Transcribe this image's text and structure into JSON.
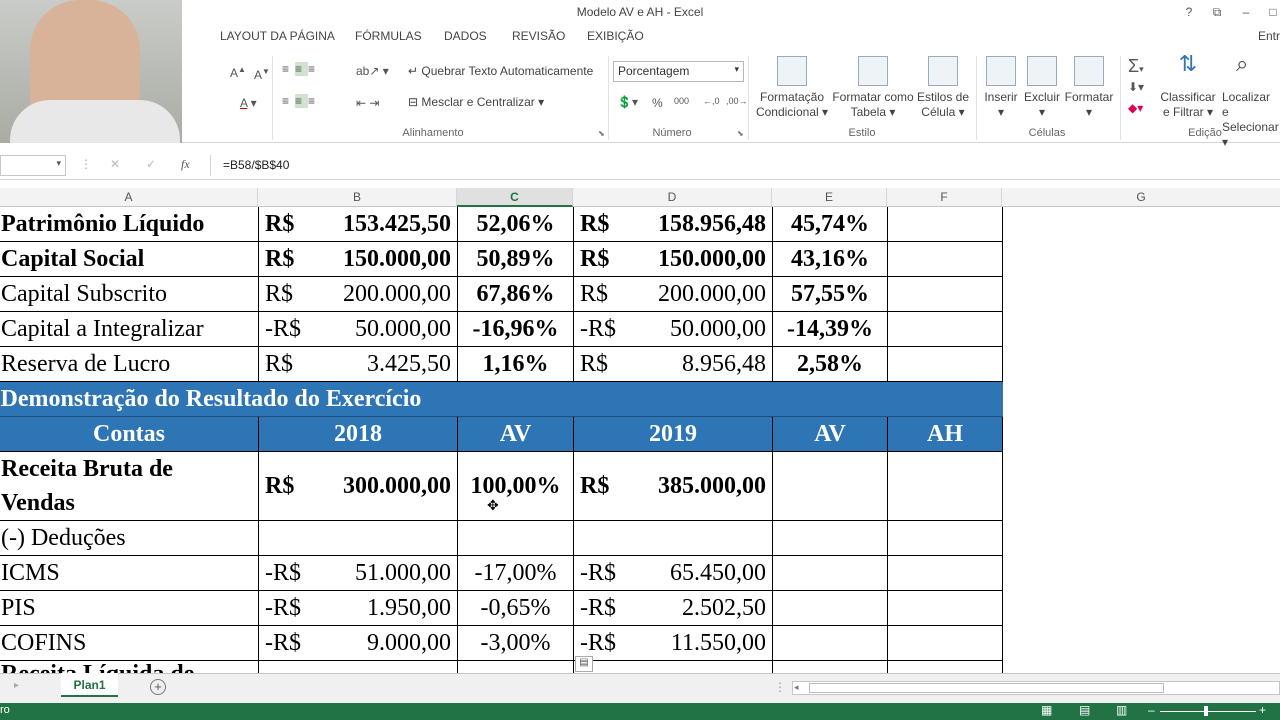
{
  "window": {
    "title": "Modelo AV e AH - Excel",
    "help": "?",
    "restore": "⧉",
    "minimize": "–",
    "maximize": "□"
  },
  "tabs": [
    "LAYOUT DA PÁGINA",
    "FÓRMULAS",
    "DADOS",
    "REVISÃO",
    "EXIBIÇÃO"
  ],
  "tab_right": "Entr",
  "ribbon": {
    "wrap_text": "Quebrar Texto Automaticamente",
    "merge_center": "Mesclar e Centralizar",
    "number_format": "Porcentagem",
    "conditional_format_1": "Formatação",
    "conditional_format_2": "Condicional",
    "format_table_1": "Formatar como",
    "format_table_2": "Tabela",
    "cell_styles_1": "Estilos de",
    "cell_styles_2": "Célula",
    "insert": "Inserir",
    "delete": "Excluir",
    "format": "Formatar",
    "sort_filter_1": "Classificar",
    "sort_filter_2": "e Filtrar",
    "find_select_1": "Localizar e",
    "find_select_2": "Selecionar",
    "groups": {
      "alignment": "Alinhamento",
      "number": "Número",
      "style": "Estilo",
      "cells": "Células",
      "editing": "Edição"
    }
  },
  "formula": {
    "value": "=B58/$B$40",
    "fx": "fx"
  },
  "columns": [
    "A",
    "B",
    "C",
    "D",
    "E",
    "F",
    "G"
  ],
  "rows": [
    {
      "a": "Patrimônio Líquido",
      "b_cur": "R$",
      "b": "153.425,50",
      "c": "52,06%",
      "d_cur": "R$",
      "d": "158.956,48",
      "e": "45,74%",
      "bold": true
    },
    {
      "a": "Capital Social",
      "b_cur": "R$",
      "b": "150.000,00",
      "c": "50,89%",
      "d_cur": "R$",
      "d": "150.000,00",
      "e": "43,16%",
      "bold": true
    },
    {
      "a": "Capital Subscrito",
      "b_cur": "R$",
      "b": "200.000,00",
      "c": "67,86%",
      "d_cur": "R$",
      "d": "200.000,00",
      "e": "57,55%"
    },
    {
      "a": "Capital a Integralizar",
      "b_cur": "-R$",
      "b": "50.000,00",
      "c": "-16,96%",
      "d_cur": "-R$",
      "d": "50.000,00",
      "e": "-14,39%"
    },
    {
      "a": "Reserva de Lucro",
      "b_cur": "R$",
      "b": "3.425,50",
      "c": "1,16%",
      "d_cur": "R$",
      "d": "8.956,48",
      "e": "2,58%"
    }
  ],
  "dre": {
    "title": "Demonstração do Resultado do Exercício",
    "headers": [
      "Contas",
      "2018",
      "AV",
      "2019",
      "AV",
      "AH"
    ],
    "revenue_label_1": "Receita Bruta de",
    "revenue_label_2": "Vendas",
    "revenue_b_cur": "R$",
    "revenue_b": "300.000,00",
    "revenue_c": "100,00%",
    "revenue_d_cur": "R$",
    "revenue_d": "385.000,00",
    "deductions": "(-) Deduções",
    "items": [
      {
        "a": "ICMS",
        "b_cur": "-R$",
        "b": "51.000,00",
        "c": "-17,00%",
        "d_cur": "-R$",
        "d": "65.450,00"
      },
      {
        "a": "PIS",
        "b_cur": "-R$",
        "b": "1.950,00",
        "c": "-0,65%",
        "d_cur": "-R$",
        "d": "2.502,50"
      },
      {
        "a": "COFINS",
        "b_cur": "-R$",
        "b": "9.000,00",
        "c": "-3,00%",
        "d_cur": "-R$",
        "d": "11.550,00"
      }
    ],
    "partial_row": "Receita Líquida de"
  },
  "sheet": {
    "tab": "Plan1",
    "add": "+"
  },
  "status": {
    "text": "ro"
  }
}
